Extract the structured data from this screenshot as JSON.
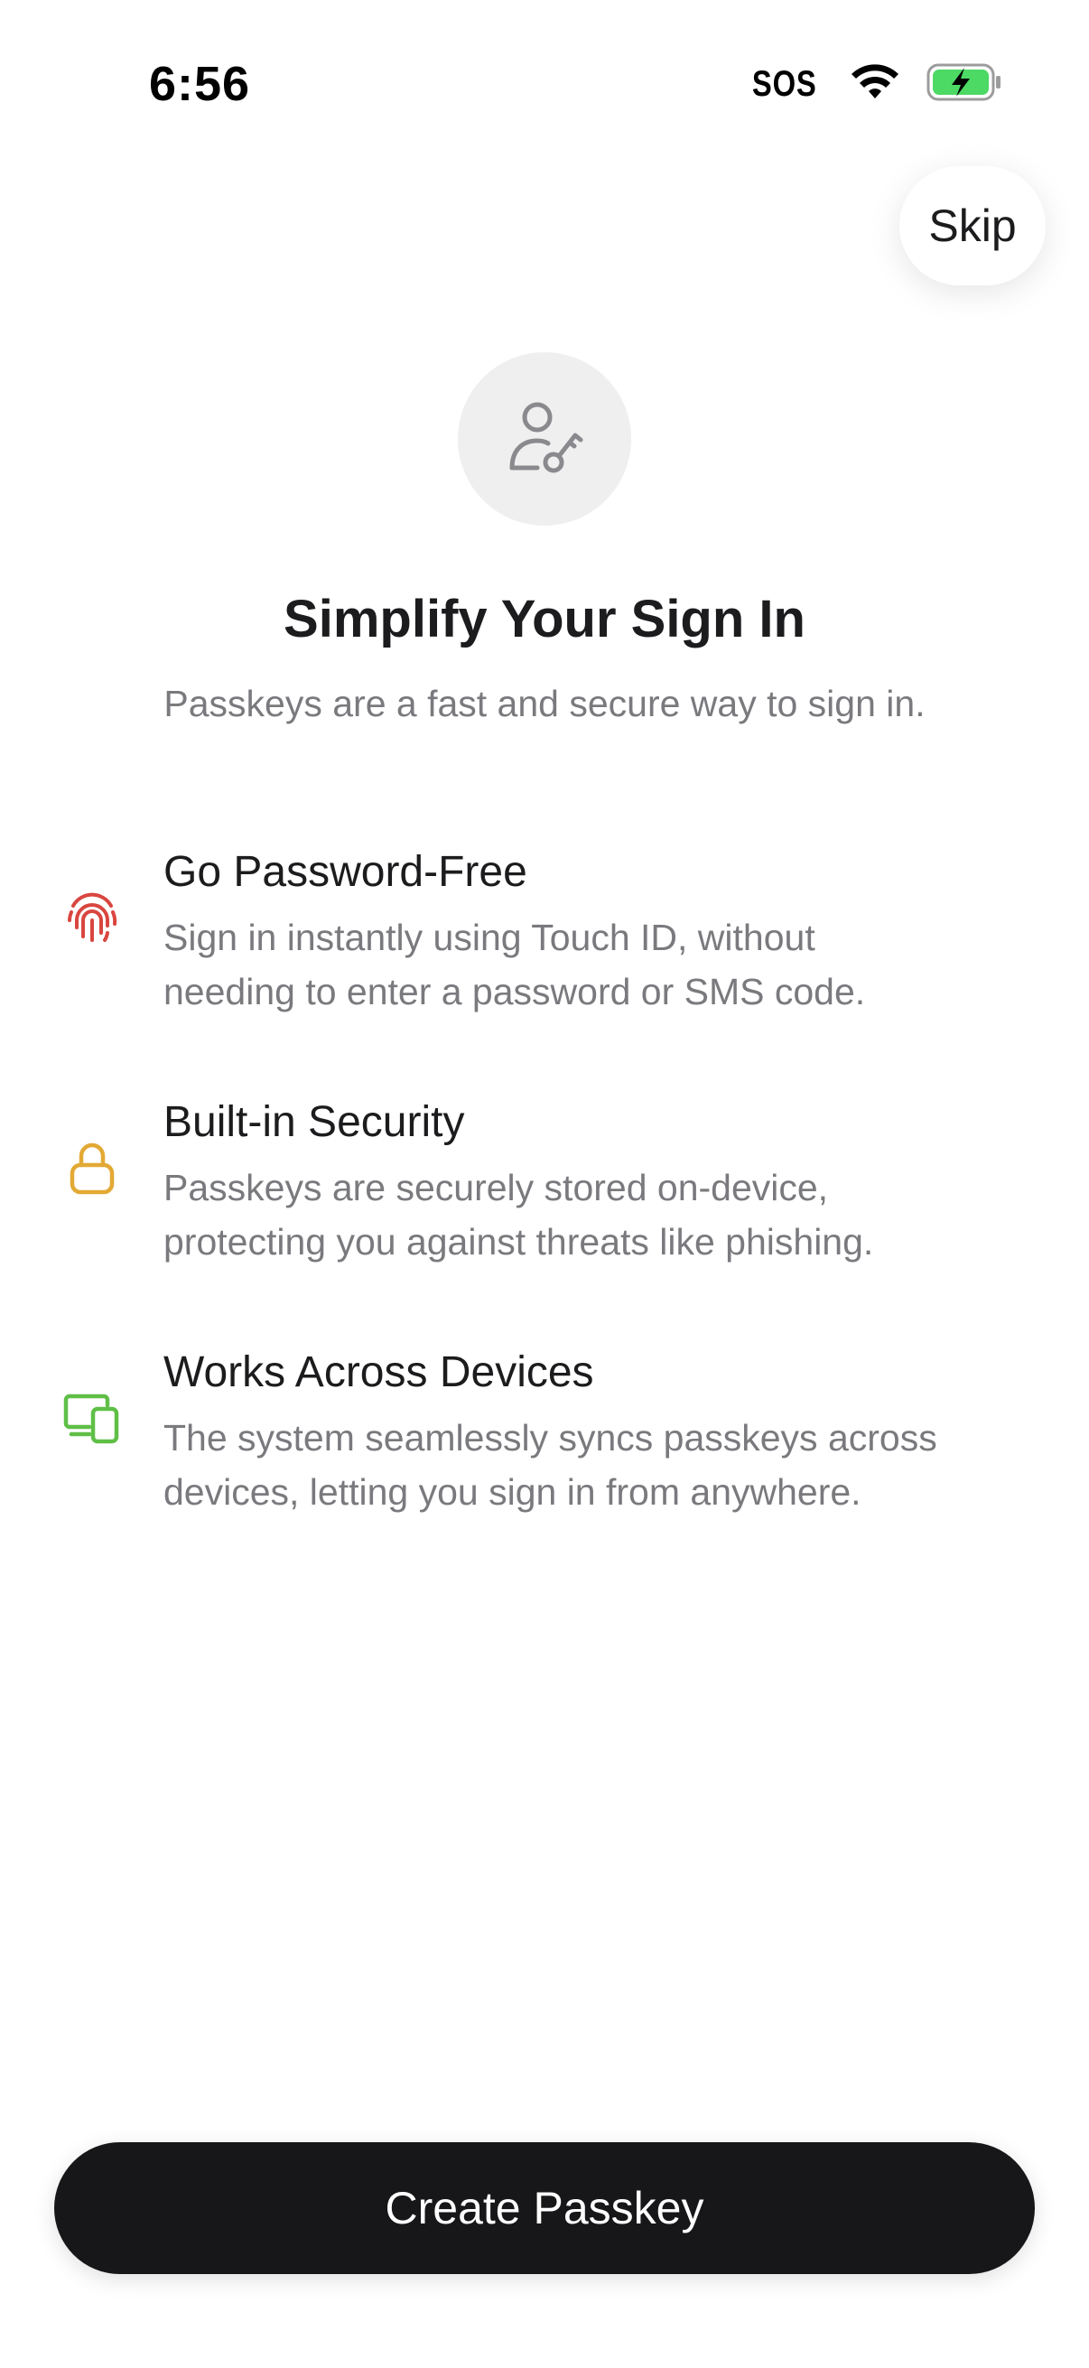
{
  "status_bar": {
    "time": "6:56",
    "carrier": "SOS",
    "icons": [
      "wifi-icon",
      "battery-charging-icon"
    ],
    "battery_color": "#4cd964"
  },
  "skip_label": "Skip",
  "hero": {
    "icon": "person-key-icon",
    "title": "Simplify Your Sign In",
    "subtitle": "Passkeys are a fast and secure way to sign in."
  },
  "features": [
    {
      "icon": "fingerprint-icon",
      "icon_color": "#d9463f",
      "title": "Go Password-Free",
      "desc_lines": [
        "Sign in instantly using Touch ID, without",
        "needing to enter a password or SMS code."
      ]
    },
    {
      "icon": "lock-icon",
      "icon_color": "#e3a935",
      "title": "Built-in Security",
      "desc_lines": [
        "Passkeys are securely stored on-device,",
        "protecting you against threats like phishing."
      ]
    },
    {
      "icon": "devices-icon",
      "icon_color": "#5fbf47",
      "title": "Works Across Devices",
      "desc_lines": [
        "The system seamlessly syncs passkeys across",
        "devices, letting you sign in from anywhere."
      ]
    }
  ],
  "primary_button_label": "Create Passkey"
}
